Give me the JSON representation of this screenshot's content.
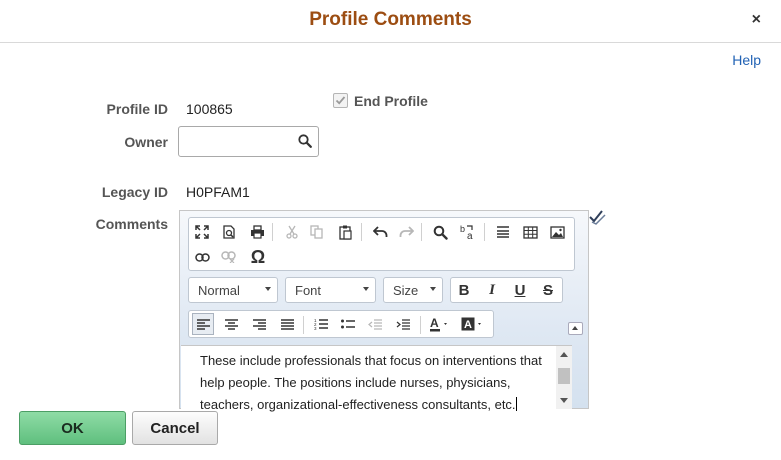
{
  "dialog": {
    "title": "Profile Comments",
    "close_glyph": "×",
    "help_label": "Help"
  },
  "form": {
    "profile_id_label": "Profile ID",
    "profile_id_value": "100865",
    "end_profile_label": "End Profile",
    "end_profile_checked": true,
    "owner_label": "Owner",
    "owner_value": "",
    "legacy_id_label": "Legacy ID",
    "legacy_id_value": "H0PFAM1",
    "comments_label": "Comments"
  },
  "editor": {
    "format_combo": "Normal",
    "font_combo": "Font",
    "size_combo": "Size",
    "bold": "B",
    "italic": "I",
    "underline": "U",
    "strike": "S",
    "omega": "Ω",
    "text": "These include professionals that focus on interventions that help people. The positions include nurses, physicians, teachers, organizational-effectiveness consultants, etc."
  },
  "buttons": {
    "ok": "OK",
    "cancel": "Cancel"
  },
  "colors": {
    "title": "#9c4d12",
    "link": "#2162b4",
    "ok_bg": "#6ccb8b"
  }
}
